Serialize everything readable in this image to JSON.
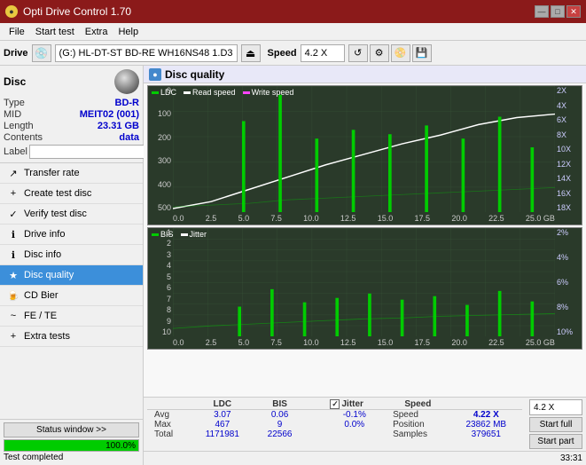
{
  "app": {
    "title": "Opti Drive Control 1.70",
    "icon": "●"
  },
  "titlebar": {
    "minimize": "—",
    "maximize": "□",
    "close": "✕"
  },
  "menu": {
    "items": [
      "File",
      "Start test",
      "Extra",
      "Help"
    ]
  },
  "drive_toolbar": {
    "drive_label": "Drive",
    "drive_value": "(G:)  HL-DT-ST BD-RE  WH16NS48 1.D3",
    "speed_label": "Speed",
    "speed_value": "4.2 X"
  },
  "sidebar": {
    "disc_title": "Disc",
    "disc_type_label": "Type",
    "disc_type_value": "BD-R",
    "disc_mid_label": "MID",
    "disc_mid_value": "MEIT02 (001)",
    "disc_length_label": "Length",
    "disc_length_value": "23.31 GB",
    "disc_contents_label": "Contents",
    "disc_contents_value": "data",
    "disc_label_label": "Label",
    "disc_label_placeholder": "",
    "nav_items": [
      {
        "id": "transfer-rate",
        "label": "Transfer rate",
        "icon": "↗"
      },
      {
        "id": "create-test-disc",
        "label": "Create test disc",
        "icon": "+"
      },
      {
        "id": "verify-test-disc",
        "label": "Verify test disc",
        "icon": "✓"
      },
      {
        "id": "drive-info",
        "label": "Drive info",
        "icon": "i"
      },
      {
        "id": "disc-info",
        "label": "Disc info",
        "icon": "i"
      },
      {
        "id": "disc-quality",
        "label": "Disc quality",
        "icon": "★",
        "active": true
      },
      {
        "id": "cd-bier",
        "label": "CD Bier",
        "icon": "🍺"
      },
      {
        "id": "fe-te",
        "label": "FE / TE",
        "icon": "~"
      },
      {
        "id": "extra-tests",
        "label": "Extra tests",
        "icon": "+"
      }
    ],
    "status_btn": "Status window >>",
    "progress_value": 100,
    "progress_text": "100.0%",
    "status_text": "Test completed"
  },
  "disc_quality": {
    "title": "Disc quality",
    "upper_chart": {
      "legend": [
        {
          "label": "LDC",
          "color": "#00cc00"
        },
        {
          "label": "Read speed",
          "color": "white"
        },
        {
          "label": "Write speed",
          "color": "#ff44ff"
        }
      ],
      "y_left_labels": [
        "0",
        "100",
        "200",
        "300",
        "400",
        "500"
      ],
      "y_right_labels": [
        "2X",
        "4X",
        "6X",
        "8X",
        "10X",
        "12X",
        "14X",
        "16X",
        "18X"
      ],
      "x_labels": [
        "0.0",
        "2.5",
        "5.0",
        "7.5",
        "10.0",
        "12.5",
        "15.0",
        "17.5",
        "20.0",
        "22.5",
        "25.0 GB"
      ]
    },
    "lower_chart": {
      "legend": [
        {
          "label": "BIS",
          "color": "#00cc00"
        },
        {
          "label": "Jitter",
          "color": "white"
        }
      ],
      "y_left_labels": [
        "1",
        "2",
        "3",
        "4",
        "5",
        "6",
        "7",
        "8",
        "9",
        "10"
      ],
      "y_right_labels": [
        "2%",
        "4%",
        "6%",
        "8%",
        "10%"
      ],
      "x_labels": [
        "0.0",
        "2.5",
        "5.0",
        "7.5",
        "10.0",
        "12.5",
        "15.0",
        "17.5",
        "20.0",
        "22.5",
        "25.0 GB"
      ]
    }
  },
  "stats": {
    "col_headers": [
      "LDC",
      "BIS",
      "",
      "Jitter",
      "Speed",
      ""
    ],
    "rows": [
      {
        "label": "Avg",
        "ldc": "3.07",
        "bis": "0.06",
        "jitter": "-0.1%",
        "speed_label": "Speed",
        "speed_val": "4.22 X"
      },
      {
        "label": "Max",
        "ldc": "467",
        "bis": "9",
        "jitter": "0.0%",
        "pos_label": "Position",
        "pos_val": "23862 MB"
      },
      {
        "label": "Total",
        "ldc": "1171981",
        "bis": "22566",
        "jitter": "",
        "samples_label": "Samples",
        "samples_val": "379651"
      }
    ],
    "jitter_checked": true,
    "jitter_label": "Jitter",
    "speed_dropdown": "4.2 X",
    "btn_start_full": "Start full",
    "btn_start_part": "Start part"
  },
  "time": "33:31"
}
